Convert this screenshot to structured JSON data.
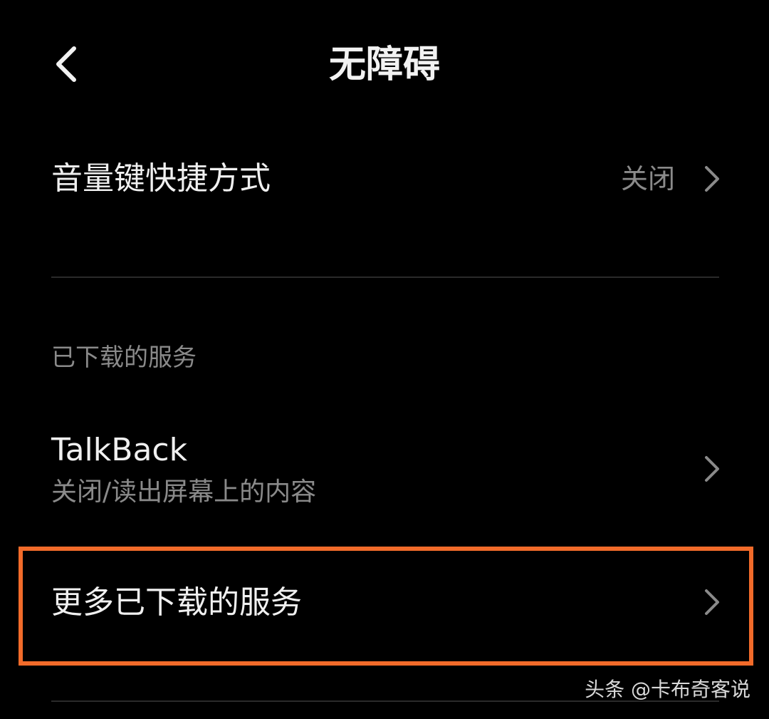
{
  "header": {
    "title": "无障碍"
  },
  "rows": {
    "volume_shortcut": {
      "label": "音量键快捷方式",
      "value": "关闭"
    },
    "talkback": {
      "label": "TalkBack",
      "subtitle": "关闭/读出屏幕上的内容"
    },
    "more_services": {
      "label": "更多已下载的服务"
    }
  },
  "section": {
    "downloaded_services": "已下载的服务"
  },
  "watermark": {
    "text": "头条 @卡布奇客说"
  },
  "colors": {
    "background": "#000000",
    "highlight": "#f26b2a",
    "secondary_text": "#8a8a8a"
  },
  "icons": {
    "back": "chevron-left-icon",
    "row_arrow": "chevron-right-icon"
  }
}
